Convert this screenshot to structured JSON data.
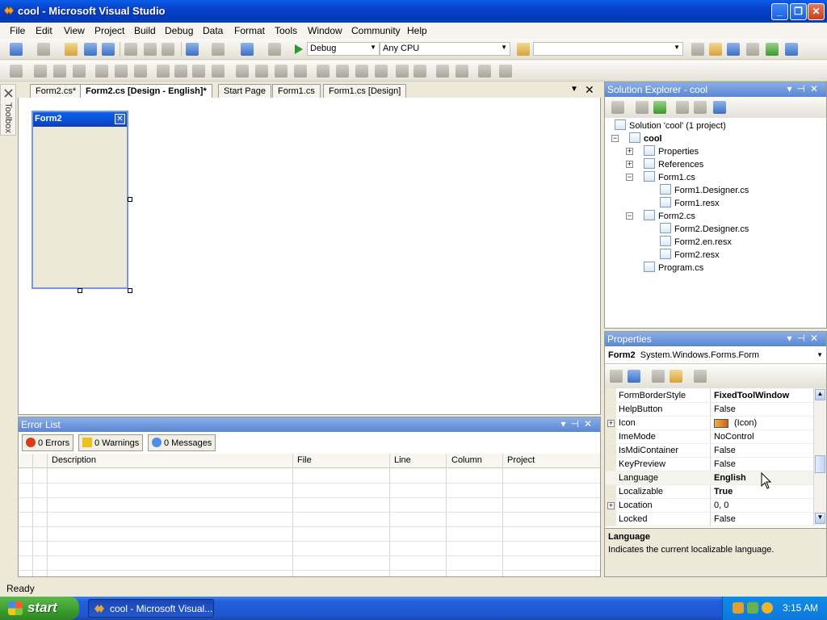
{
  "window": {
    "title": "cool - Microsoft Visual Studio",
    "buttons": [
      "_",
      "❐",
      "✕"
    ]
  },
  "menu": [
    "File",
    "Edit",
    "View",
    "Project",
    "Build",
    "Debug",
    "Data",
    "Format",
    "Tools",
    "Window",
    "Community",
    "Help"
  ],
  "toolbar": {
    "config": "Debug",
    "platform": "Any CPU",
    "find_combo": ""
  },
  "toolbox": {
    "label": "Toolbox"
  },
  "doc_tabs": [
    "Form2.cs*",
    "Form2.cs [Design - English]*",
    "Start Page",
    "Form1.cs",
    "Form1.cs [Design]"
  ],
  "doc_tab_active_index": 1,
  "designer": {
    "form_title": "Form2",
    "form_close": "✕"
  },
  "error_list": {
    "title": "Error List",
    "errors_btn": "0 Errors",
    "warnings_btn": "0 Warnings",
    "messages_btn": "0 Messages",
    "columns": [
      "Description",
      "File",
      "Line",
      "Column",
      "Project"
    ]
  },
  "solution_explorer": {
    "title": "Solution Explorer - cool",
    "items": [
      {
        "label": "Solution 'cool' (1 project)"
      },
      {
        "label": "cool"
      },
      {
        "label": "Properties"
      },
      {
        "label": "References"
      },
      {
        "label": "Form1.cs"
      },
      {
        "label": "Form1.Designer.cs"
      },
      {
        "label": "Form1.resx"
      },
      {
        "label": "Form2.cs"
      },
      {
        "label": "Form2.Designer.cs"
      },
      {
        "label": "Form2.en.resx"
      },
      {
        "label": "Form2.resx"
      },
      {
        "label": "Program.cs"
      }
    ]
  },
  "properties": {
    "title": "Properties",
    "object_name": "Form2",
    "object_type": "System.Windows.Forms.Form",
    "rows": [
      {
        "name": "FormBorderStyle",
        "value": "FixedToolWindow",
        "bold": true
      },
      {
        "name": "HelpButton",
        "value": "False",
        "bold": false
      },
      {
        "name": "Icon",
        "value": "(Icon)",
        "bold": false
      },
      {
        "name": "ImeMode",
        "value": "NoControl",
        "bold": false
      },
      {
        "name": "IsMdiContainer",
        "value": "False",
        "bold": false
      },
      {
        "name": "KeyPreview",
        "value": "False",
        "bold": false
      },
      {
        "name": "Language",
        "value": "English",
        "bold": true
      },
      {
        "name": "Localizable",
        "value": "True",
        "bold": true
      },
      {
        "name": "Location",
        "value": "0, 0",
        "bold": false
      },
      {
        "name": "Locked",
        "value": "False",
        "bold": false
      }
    ],
    "desc_title": "Language",
    "desc_text": "Indicates the current localizable language."
  },
  "status": {
    "text": "Ready"
  },
  "taskbar": {
    "start": "start",
    "task": "cool - Microsoft Visual...",
    "clock": "3:15 AM"
  }
}
